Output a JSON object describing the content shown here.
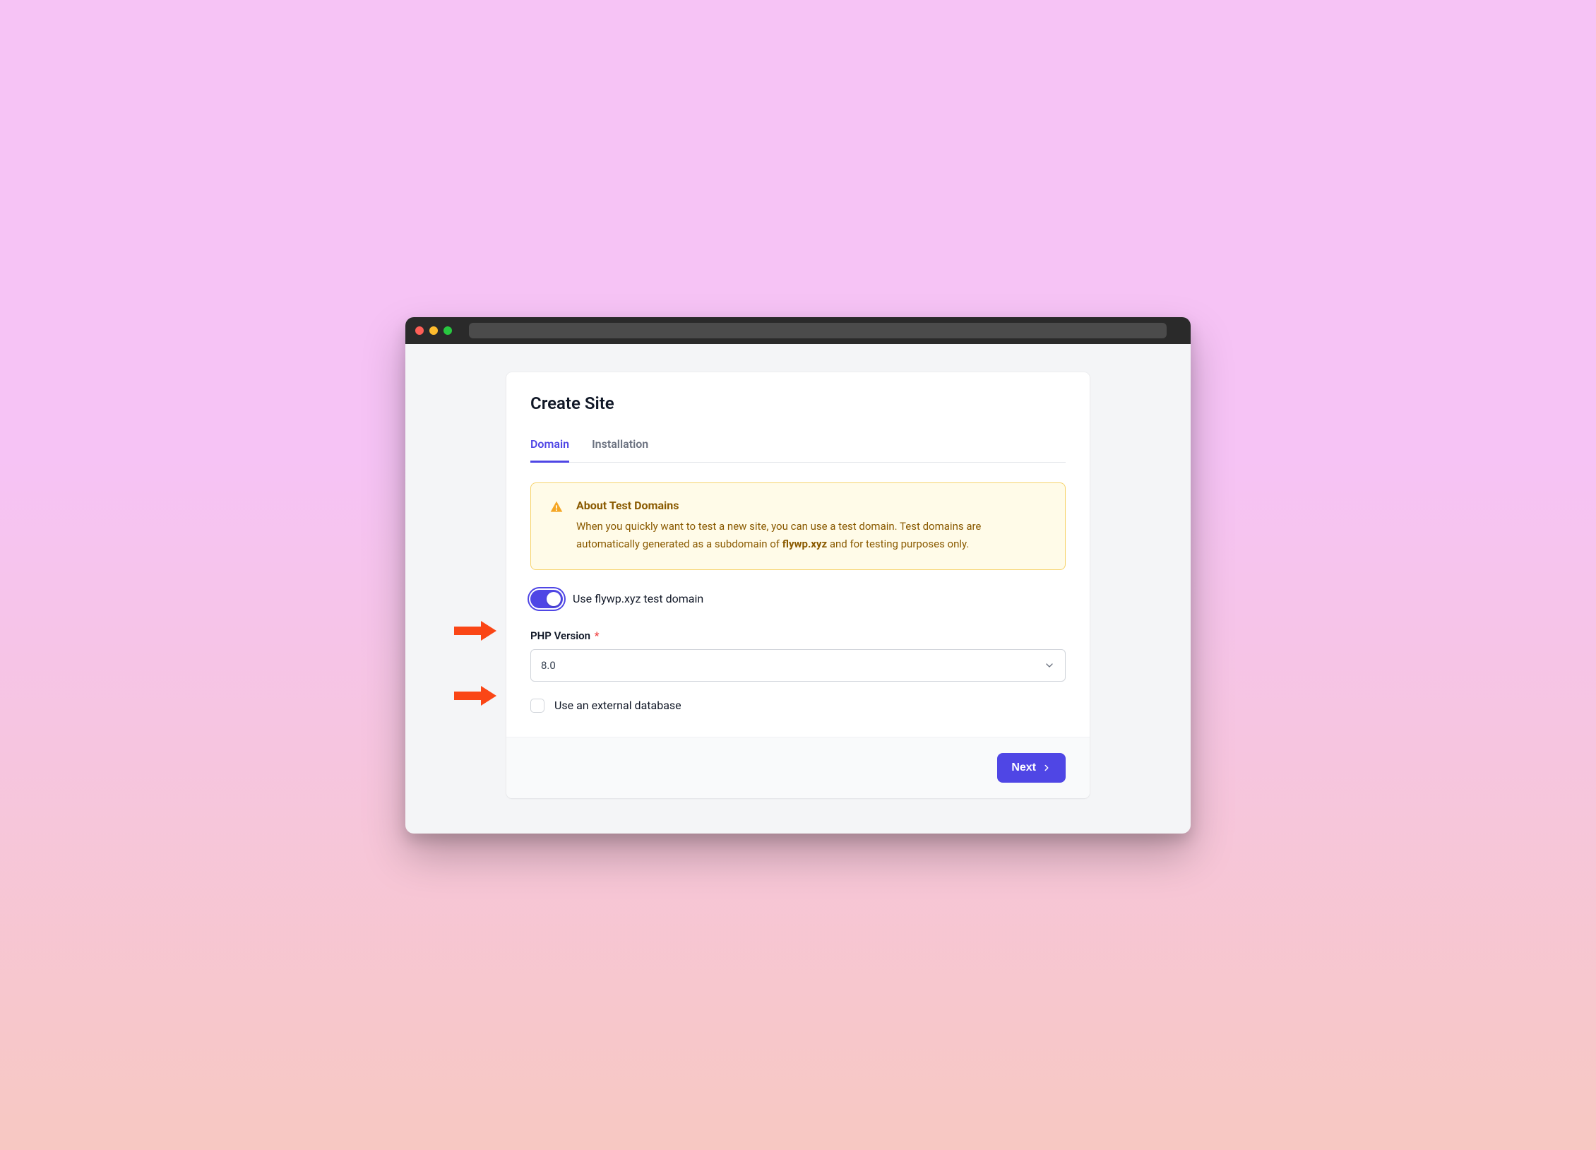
{
  "page": {
    "title": "Create Site"
  },
  "tabs": {
    "domain": "Domain",
    "installation": "Installation"
  },
  "alert": {
    "title": "About Test Domains",
    "body_prefix": "When you quickly want to test a new site, you can use a test domain. Test domains are automatically generated as a subdomain of ",
    "body_bold": "flywp.xyz",
    "body_suffix": " and for testing purposes only."
  },
  "toggle": {
    "label": "Use flywp.xyz test domain",
    "on": true
  },
  "php": {
    "label": "PHP Version",
    "required_mark": "*",
    "value": "8.0"
  },
  "external_db": {
    "label": "Use an external database",
    "checked": false
  },
  "footer": {
    "next": "Next"
  },
  "colors": {
    "primary": "#4f46e5",
    "warning_bg": "#fffbe8",
    "warning_border": "#f6d36b",
    "warning_text": "#8a5a00",
    "annotation": "#fa4616"
  }
}
